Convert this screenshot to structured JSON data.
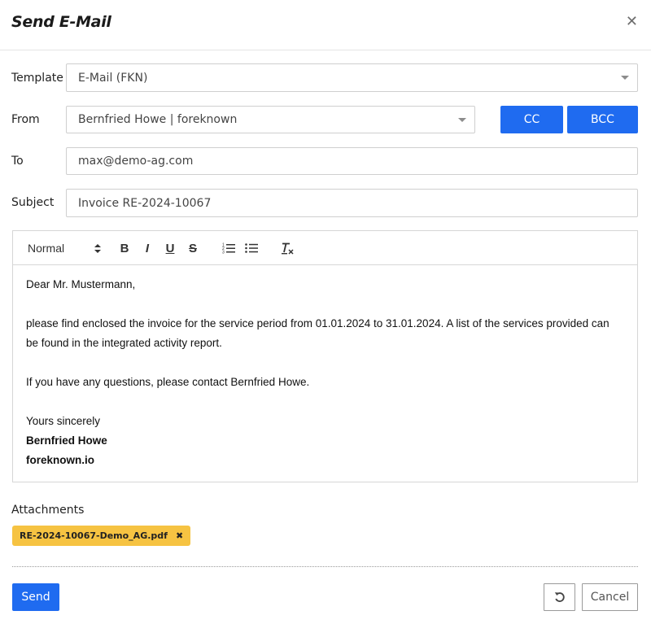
{
  "dialog": {
    "title": "Send E-Mail"
  },
  "form": {
    "template": {
      "label": "Template",
      "value": "E-Mail (FKN)"
    },
    "from": {
      "label": "From",
      "value": "Bernfried Howe | foreknown"
    },
    "cc_label": "CC",
    "bcc_label": "BCC",
    "to": {
      "label": "To",
      "value": "max@demo-ag.com"
    },
    "subject": {
      "label": "Subject",
      "value": "Invoice RE-2024-10067"
    }
  },
  "editor": {
    "format_select": "Normal",
    "toolbar_glyphs": {
      "bold": "B",
      "italic": "I",
      "underline": "U",
      "strike": "S"
    },
    "body": {
      "greeting": "Dear Mr. Mustermann,",
      "paragraph1": "please find enclosed the invoice for the service period from 01.01.2024 to 31.01.2024. A list of the services provided can be found in the integrated activity report.",
      "paragraph2": "If you have any questions, please contact Bernfried Howe.",
      "closing": "Yours sincerely",
      "signature_name": "Bernfried Howe",
      "signature_company": "foreknown.io"
    }
  },
  "attachments": {
    "label": "Attachments",
    "files": [
      "RE-2024-10067-Demo_AG.pdf"
    ],
    "chip_color": "#f6c342"
  },
  "footer": {
    "send_label": "Send",
    "cancel_label": "Cancel"
  },
  "colors": {
    "primary": "#1f6bf0"
  },
  "icons": {
    "close": "close-icon",
    "reset": "undo-icon",
    "remove_attachment": "close-icon"
  }
}
